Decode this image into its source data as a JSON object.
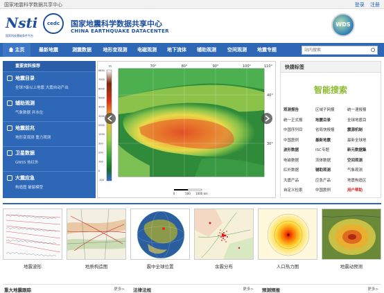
{
  "topbar": {
    "site_name": "国家地震科学数据共享中心",
    "login": "登录",
    "register": "注册"
  },
  "header": {
    "logo_text": "Nsti",
    "logo_badge": "cedc",
    "logo_sub": "国家科技基础条件平台",
    "title_cn": "国家地震科学数据共享中心",
    "title_en": "CHINA EARTHQUAKE DATACENTER",
    "wds_label": "WDS"
  },
  "nav": {
    "home": "主页",
    "items": [
      "最新地震",
      "测震数据",
      "地形变观测",
      "电磁观测",
      "地下流体",
      "辅助观测",
      "空间观测",
      "地震专题"
    ]
  },
  "search": {
    "placeholder": "站内搜索"
  },
  "left_panel": {
    "title": "重要资料推荐",
    "sections": [
      {
        "title": "地震目录",
        "sub": "全球7级以上地震   大震自动产出"
      },
      {
        "title": "辅助观测",
        "sub": "气象数据   井水位"
      },
      {
        "title": "地震前兆",
        "sub": "地形变观测   重力观测"
      },
      {
        "title": "卫星数据",
        "sub": "GNSS   热红外"
      },
      {
        "title": "大震应急",
        "sub": "构造图   破裂模型"
      }
    ]
  },
  "map": {
    "lon_labels": [
      "70°",
      "80°",
      "90°",
      "100°",
      "110°"
    ],
    "lat_labels": [
      "40°",
      "30°"
    ],
    "scale_labels": [
      "0",
      "500",
      "1000 km"
    ],
    "legend_unit": "m",
    "legend_values": [
      "8850",
      "7000",
      "6000",
      "5000",
      "4000",
      "3000",
      "2000",
      "1000",
      "500",
      "200",
      "100",
      "0",
      "-100"
    ]
  },
  "right_panel": {
    "title": "快捷标签",
    "smart_search": "智能搜索",
    "tags": [
      {
        "label": "观测报告",
        "style": "b"
      },
      {
        "label": "区域子网报",
        "style": ""
      },
      {
        "label": "统一速报报",
        "style": ""
      },
      {
        "label": "统一正式报",
        "style": ""
      },
      {
        "label": "地震目录",
        "style": "b"
      },
      {
        "label": "全球地震目",
        "style": ""
      },
      {
        "label": "中国序列目",
        "style": ""
      },
      {
        "label": "省局快报报",
        "style": ""
      },
      {
        "label": "震源机制",
        "style": "b"
      },
      {
        "label": "中国震例",
        "style": ""
      },
      {
        "label": "最新地震",
        "style": "b"
      },
      {
        "label": "最新全球地",
        "style": ""
      },
      {
        "label": "波形数据",
        "style": "b"
      },
      {
        "label": "ISC专题",
        "style": ""
      },
      {
        "label": "新元数据集",
        "style": "b"
      },
      {
        "label": "电磁数据",
        "style": ""
      },
      {
        "label": "流体数据",
        "style": ""
      },
      {
        "label": "空间观测",
        "style": "b"
      },
      {
        "label": "红外数据",
        "style": ""
      },
      {
        "label": "辅助观测",
        "style": "b"
      },
      {
        "label": "气象观测",
        "style": ""
      },
      {
        "label": "大震产品",
        "style": ""
      },
      {
        "label": "应急产品",
        "style": ""
      },
      {
        "label": "地震构造区",
        "style": ""
      },
      {
        "label": "自定义检索",
        "style": ""
      },
      {
        "label": "中国震例",
        "style": ""
      },
      {
        "label": "用户帮助",
        "style": "r"
      }
    ]
  },
  "thumbnails": [
    {
      "caption": "地震波形"
    },
    {
      "caption": "地质构造图"
    },
    {
      "caption": "震中全球位置"
    },
    {
      "caption": "余震分布"
    },
    {
      "caption": "人口热力图"
    },
    {
      "caption": "地震动预测"
    }
  ],
  "bottom": [
    {
      "title": "重大地震跟踪",
      "more": "更多>"
    },
    {
      "title": "法律法规",
      "more": "更多>"
    },
    {
      "title": "预测预报",
      "more": "更多>"
    }
  ]
}
